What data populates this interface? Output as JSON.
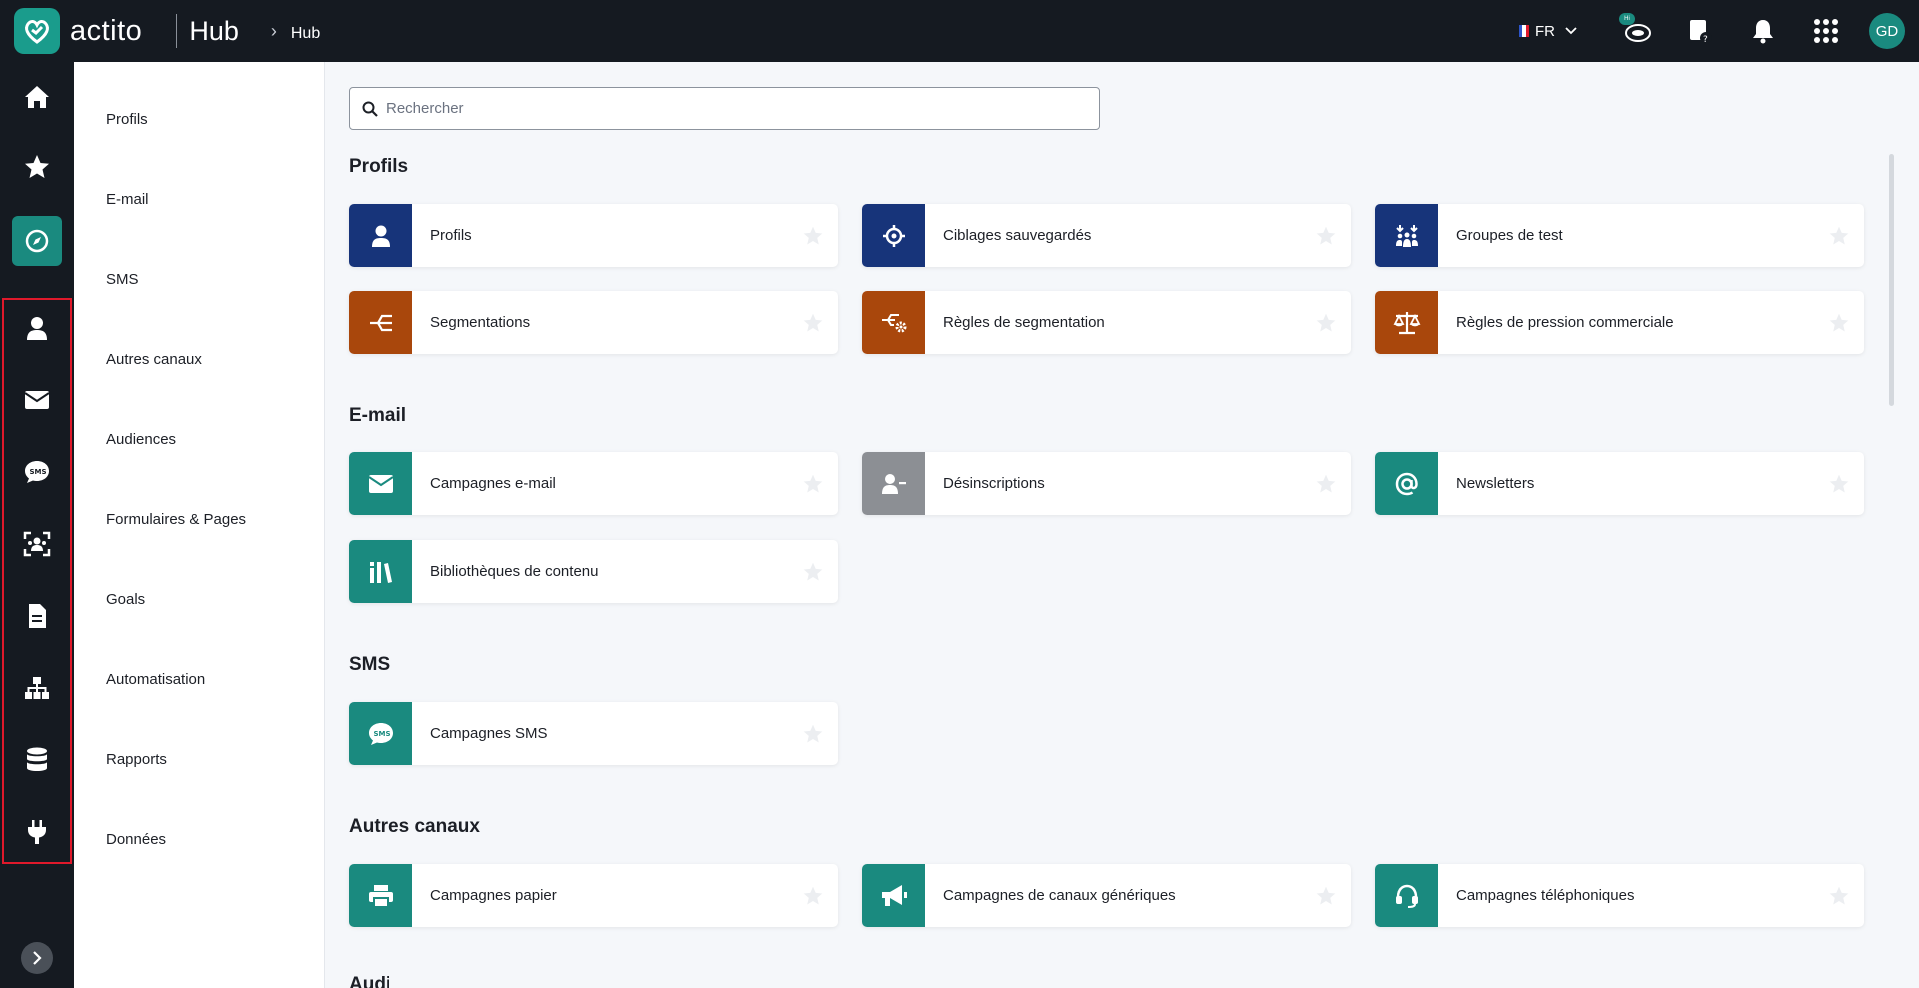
{
  "header": {
    "logo_text": "actito",
    "app_name": "Hub",
    "breadcrumb": "Hub",
    "language": "FR",
    "avatar_initials": "GD",
    "beta_badge": "Hi"
  },
  "colors": {
    "topbar": "#151a21",
    "accent_green": "#1a8a7f",
    "blue": "#17347a",
    "orange": "#a9470c",
    "grey": "#8c8f94",
    "highlight_red": "#e0192b"
  },
  "rail": {
    "items": [
      {
        "icon": "home-icon"
      },
      {
        "icon": "star-icon"
      },
      {
        "icon": "compass-icon",
        "active": true
      },
      {
        "icon": "user-icon"
      },
      {
        "icon": "envelope-icon"
      },
      {
        "icon": "sms-icon"
      },
      {
        "icon": "audience-icon"
      },
      {
        "icon": "document-icon"
      },
      {
        "icon": "hierarchy-icon"
      },
      {
        "icon": "database-icon"
      },
      {
        "icon": "plug-icon"
      }
    ],
    "expand_icon": "chevron-right-icon"
  },
  "subnav": {
    "items": [
      "Profils",
      "E-mail",
      "SMS",
      "Autres canaux",
      "Audiences",
      "Formulaires & Pages",
      "Goals",
      "Automatisation",
      "Rapports",
      "Données"
    ]
  },
  "search": {
    "placeholder": "Rechercher",
    "value": ""
  },
  "sections": [
    {
      "title": "Profils",
      "cards": [
        {
          "label": "Profils",
          "icon": "user-icon",
          "color": "blue"
        },
        {
          "label": "Ciblages sauvegardés",
          "icon": "crosshair-icon",
          "color": "blue"
        },
        {
          "label": "Groupes de test",
          "icon": "test-group-icon",
          "color": "blue"
        },
        {
          "label": "Segmentations",
          "icon": "segmentation-icon",
          "color": "orange"
        },
        {
          "label": "Règles de segmentation",
          "icon": "segmentation-rules-icon",
          "color": "orange"
        },
        {
          "label": "Règles de pression commerciale",
          "icon": "scale-icon",
          "color": "orange"
        }
      ]
    },
    {
      "title": "E-mail",
      "cards": [
        {
          "label": "Campagnes e-mail",
          "icon": "envelope-icon",
          "color": "green"
        },
        {
          "label": "Désinscriptions",
          "icon": "user-minus-icon",
          "color": "grey"
        },
        {
          "label": "Newsletters",
          "icon": "at-icon",
          "color": "green"
        },
        {
          "label": "Bibliothèques de contenu",
          "icon": "library-icon",
          "color": "green"
        }
      ]
    },
    {
      "title": "SMS",
      "cards": [
        {
          "label": "Campagnes SMS",
          "icon": "sms-icon",
          "color": "green"
        }
      ]
    },
    {
      "title": "Autres canaux",
      "cards": [
        {
          "label": "Campagnes papier",
          "icon": "printer-icon",
          "color": "green"
        },
        {
          "label": "Campagnes de canaux génériques",
          "icon": "megaphone-icon",
          "color": "green"
        },
        {
          "label": "Campagnes téléphoniques",
          "icon": "headset-icon",
          "color": "green"
        }
      ]
    }
  ],
  "next_section_title_partial": "Audiences"
}
